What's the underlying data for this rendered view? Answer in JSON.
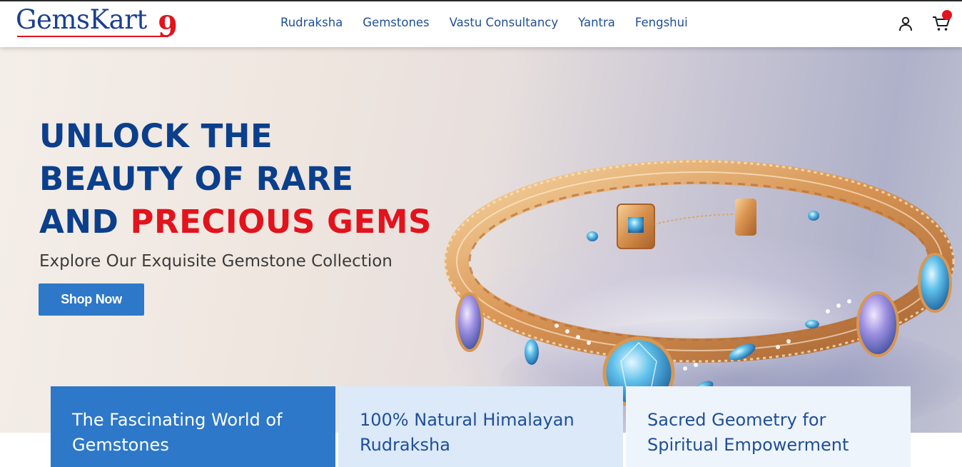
{
  "brand": {
    "logo_text": "GemsKart",
    "logo_accent": "9"
  },
  "nav": {
    "items": [
      {
        "label": "Rudraksha"
      },
      {
        "label": "Gemstones"
      },
      {
        "label": "Vastu Consultancy"
      },
      {
        "label": "Yantra"
      },
      {
        "label": "Fengshui"
      }
    ]
  },
  "header_icons": {
    "account": "user-icon",
    "cart": "cart-icon",
    "cart_badge_color": "#e2131c"
  },
  "hero": {
    "line1": "UNLOCK THE",
    "line2": "BEAUTY OF RARE",
    "line3_prefix": "AND",
    "line3_highlight": "PRECIOUS GEMS",
    "subtitle": "Explore Our Exquisite Gemstone Collection",
    "cta_label": "Shop Now",
    "image": "gold-bracelet-with-blue-gemstones"
  },
  "cards": [
    {
      "line1": "The Fascinating World of",
      "line2": "Gemstones"
    },
    {
      "line1": "100% Natural Himalayan",
      "line2": "Rudraksha"
    },
    {
      "line1": "Sacred Geometry for",
      "line2": "Spiritual Empowerment"
    }
  ],
  "colors": {
    "brand_blue": "#0b3f8c",
    "accent_red": "#e2131c",
    "button_blue": "#2d78c8"
  }
}
